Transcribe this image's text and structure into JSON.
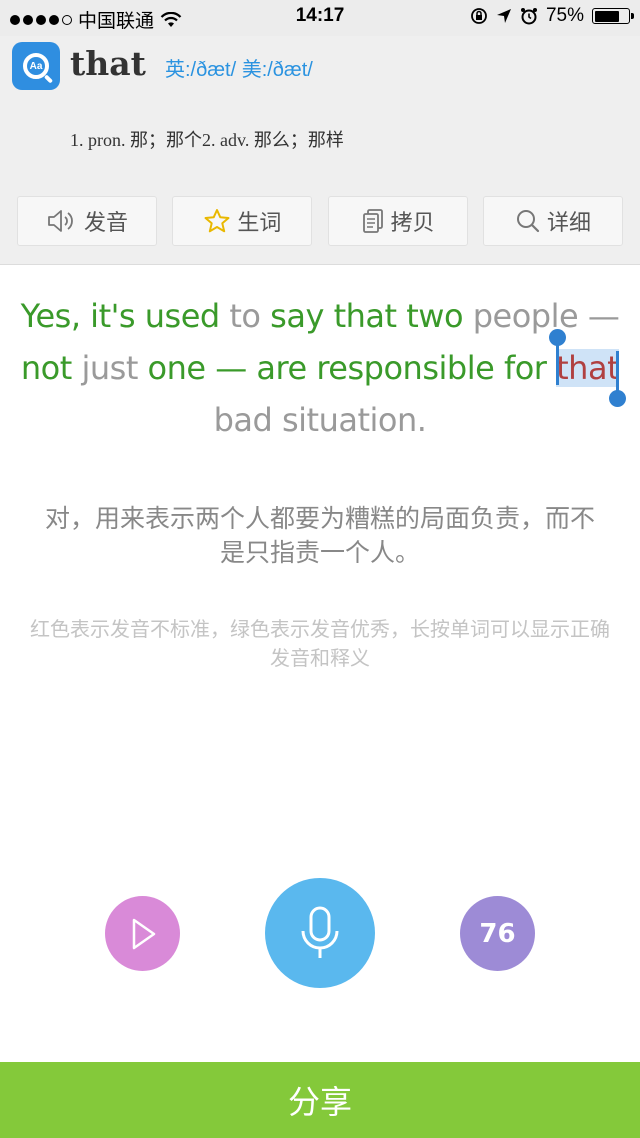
{
  "status_bar": {
    "carrier": "中国联通",
    "time": "14:17",
    "battery_percent": "75%",
    "battery_level": 0.75
  },
  "dictionary": {
    "logo_text": "Aa",
    "word": "that",
    "phonetics": "英:/ðæt/ 美:/ðæt/",
    "definition": "1. pron. 那；那个2. adv. 那么；那样",
    "actions": [
      {
        "label": "发音",
        "icon": "speaker-icon"
      },
      {
        "label": "生词",
        "icon": "star-icon"
      },
      {
        "label": "拷贝",
        "icon": "copy-icon"
      },
      {
        "label": "详细",
        "icon": "search-icon"
      }
    ]
  },
  "sentence": {
    "words": [
      {
        "text": "Yes, it's used ",
        "status": "good"
      },
      {
        "text": "to ",
        "status": "neutral"
      },
      {
        "text": "say that two ",
        "status": "good"
      },
      {
        "text": "people — ",
        "status": "neutral"
      },
      {
        "text": "not ",
        "status": "good"
      },
      {
        "text": "just ",
        "status": "neutral"
      },
      {
        "text": "one — are responsible for ",
        "status": "good"
      },
      {
        "text": "that",
        "status": "bad",
        "selected": true
      },
      {
        "text": " bad situation.",
        "status": "neutral"
      }
    ]
  },
  "translation": "对，用来表示两个人都要为糟糕的局面负责，而不是只指责一个人。",
  "hint": "红色表示发音不标准，绿色表示发音优秀，长按单词可以显示正确发音和释义",
  "controls": {
    "play_icon": "play-icon",
    "mic_icon": "microphone-icon",
    "score": "76"
  },
  "share_label": "分享",
  "colors": {
    "good": "#3a9a2a",
    "neutral": "#9a9a9a",
    "bad": "#b04040",
    "accent": "#2b93e0",
    "share_bar": "#84c93a"
  }
}
